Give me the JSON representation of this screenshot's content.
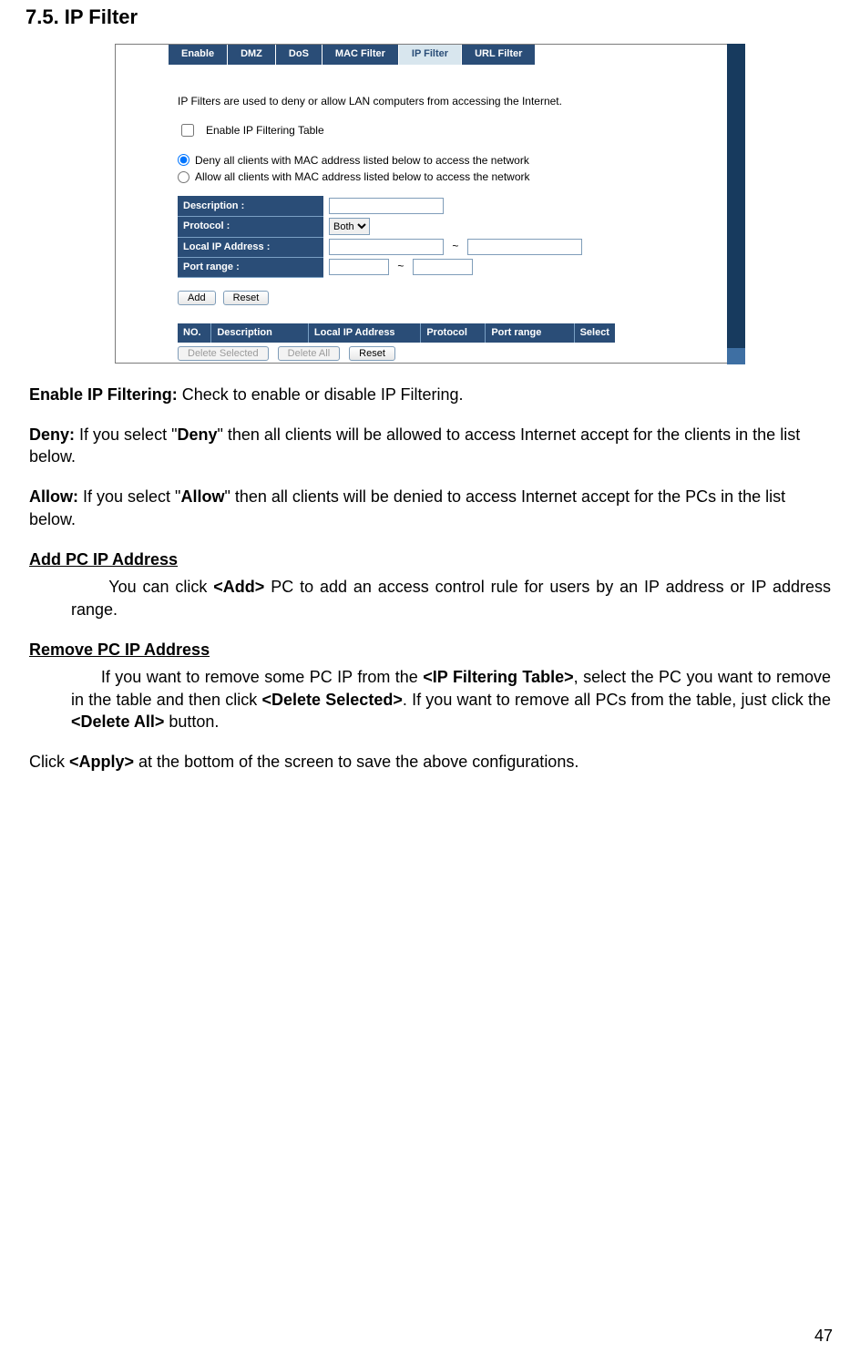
{
  "section_title": "7.5. IP Filter",
  "tabs": {
    "items": [
      "Enable",
      "DMZ",
      "DoS",
      "MAC Filter",
      "IP Filter",
      "URL Filter"
    ],
    "active_index": 4
  },
  "panel": {
    "intro": "IP Filters are used to deny or allow LAN computers from accessing the Internet.",
    "enable_label": "Enable IP Filtering Table",
    "radio_deny": "Deny all clients with MAC address listed below to access the network",
    "radio_allow": "Allow all clients with MAC address listed below to access the network",
    "form": {
      "description_label": "Description :",
      "protocol_label": "Protocol :",
      "protocol_selected": "Both",
      "localip_label": "Local IP Address :",
      "portrange_label": "Port range :"
    },
    "buttons": {
      "add": "Add",
      "reset": "Reset",
      "delete_selected": "Delete Selected",
      "delete_all": "Delete All",
      "reset2": "Reset"
    },
    "grid_headers": {
      "no": "NO.",
      "description": "Description",
      "localip": "Local IP Address",
      "protocol": "Protocol",
      "portrange": "Port range",
      "select": "Select"
    }
  },
  "desc": {
    "enable_label": "Enable IP Filtering:",
    "enable_text": " Check to enable or disable IP Filtering.",
    "deny_label": "Deny:",
    "deny_text_a": " If you select \"",
    "deny_bold": "Deny",
    "deny_text_b": "\" then all clients will be allowed to access Internet accept for the clients in the list below.",
    "allow_label": "Allow:",
    "allow_text_a": " If you select \"",
    "allow_bold": "Allow",
    "allow_text_b": "\" then all clients will be denied to access Internet accept for the PCs in the list below.",
    "add_heading": "Add PC IP Address",
    "add_text_a": "You can click ",
    "add_bold": "<Add>",
    "add_text_b": " PC to add an access control rule for users by an IP address or IP address range.",
    "remove_heading": "Remove PC IP Address",
    "remove_text_a": "If you want to remove some PC IP from the ",
    "remove_bold1": "<IP Filtering Table>",
    "remove_text_b": ", select the PC you want to remove in the table and then click ",
    "remove_bold2": "<Delete Selected>",
    "remove_text_c": ". If you want to remove all PCs from the table, just click the ",
    "remove_bold3": "<Delete All>",
    "remove_text_d": " button.",
    "apply_text_a": "Click ",
    "apply_bold": "<Apply>",
    "apply_text_b": " at the bottom of the screen to save the above configurations."
  },
  "page_number": "47"
}
